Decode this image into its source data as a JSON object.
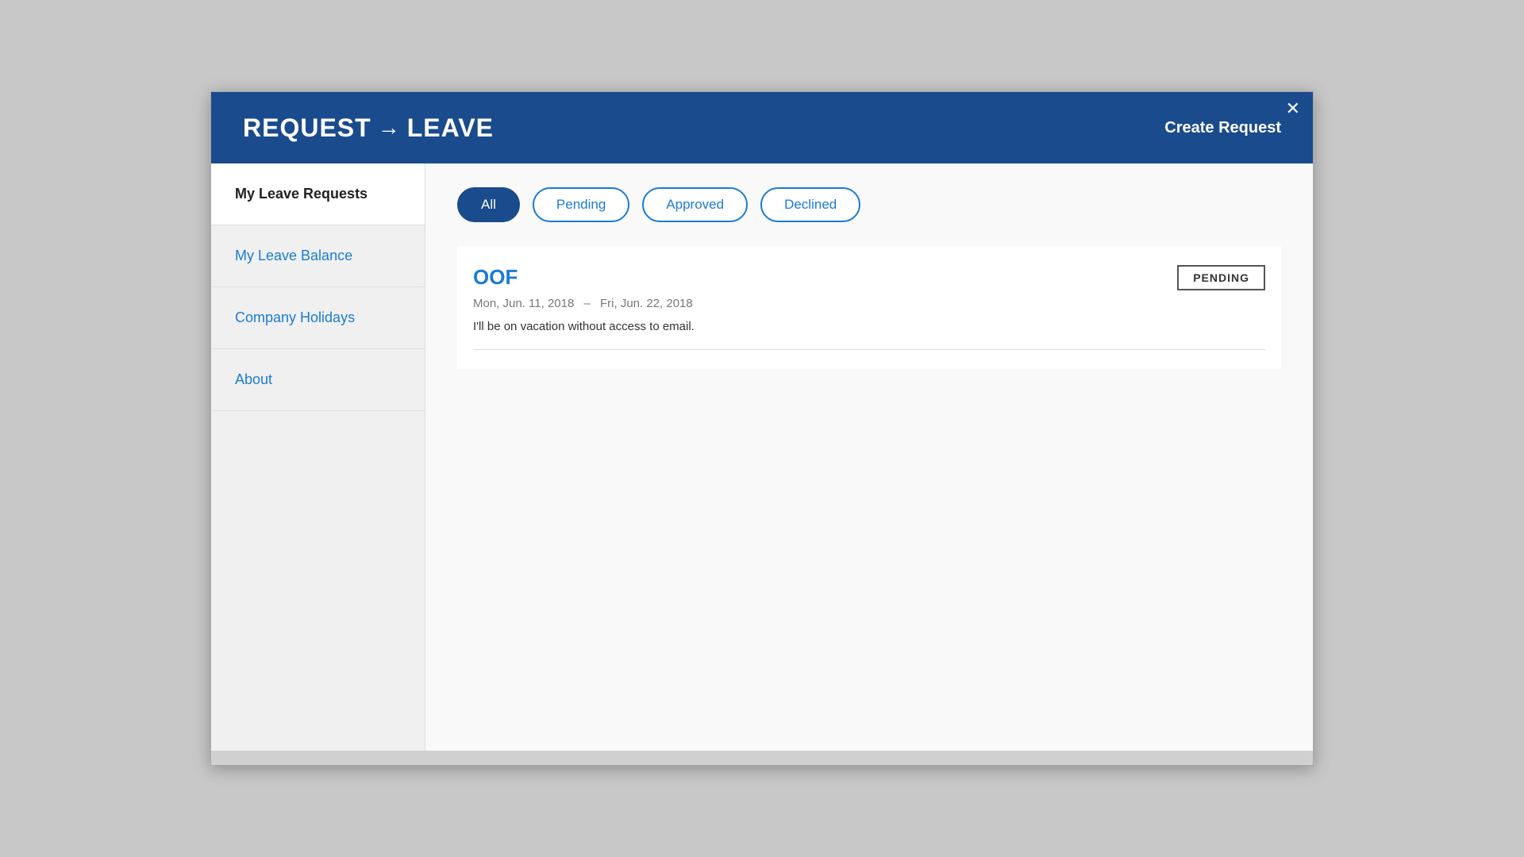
{
  "header": {
    "title_part1": "REQUEST",
    "arrow": "→",
    "title_part2": "LEAVE",
    "create_request_label": "Create Request",
    "close_label": "✕"
  },
  "sidebar": {
    "items": [
      {
        "id": "my-leave-requests",
        "label": "My Leave Requests",
        "active": true,
        "link": false
      },
      {
        "id": "my-leave-balance",
        "label": "My Leave Balance",
        "active": false,
        "link": true
      },
      {
        "id": "company-holidays",
        "label": "Company Holidays",
        "active": false,
        "link": true
      },
      {
        "id": "about",
        "label": "About",
        "active": false,
        "link": true
      }
    ]
  },
  "filter_tabs": {
    "items": [
      {
        "id": "all",
        "label": "All",
        "active": true
      },
      {
        "id": "pending",
        "label": "Pending",
        "active": false
      },
      {
        "id": "approved",
        "label": "Approved",
        "active": false
      },
      {
        "id": "declined",
        "label": "Declined",
        "active": false
      }
    ]
  },
  "leave_requests": [
    {
      "title": "OOF",
      "start_date": "Mon, Jun. 11, 2018",
      "end_date": "Fri, Jun. 22, 2018",
      "date_separator": "–",
      "description": "I'll be on vacation without access to email.",
      "status": "PENDING"
    }
  ]
}
